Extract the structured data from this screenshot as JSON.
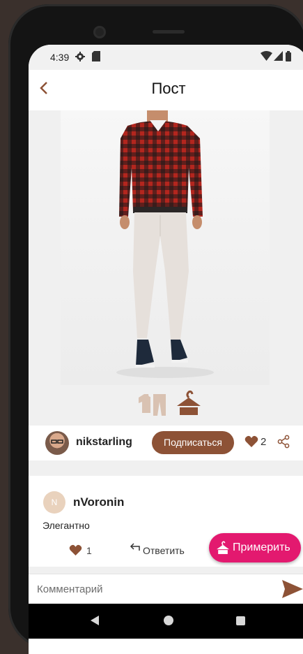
{
  "status_bar": {
    "time": "4:39",
    "icons": [
      "settings-icon",
      "sd-card-icon",
      "wifi-icon",
      "signal-icon",
      "battery-icon"
    ]
  },
  "header": {
    "title": "Пост",
    "back_icon": "chevron-left-icon"
  },
  "post": {
    "image": "man-in-plaid-shirt-and-white-jeans",
    "type_icons": [
      "clothes-icon",
      "hanger-icon"
    ],
    "author": {
      "username": "nikstarling",
      "avatar": "user-avatar-photo"
    },
    "subscribe_label": "Подписаться",
    "likes": "2",
    "share_icon": "share-icon"
  },
  "comment": {
    "avatar_letter": "N",
    "username": "nVoronin",
    "text": "Элегантно",
    "likes": "1",
    "reply_label": "Ответить"
  },
  "fitting_button": {
    "label": "Примерить",
    "icon": "hanger-icon"
  },
  "comment_bar": {
    "placeholder": "Комментарий",
    "value": ""
  },
  "colors": {
    "accent": "#8d5236",
    "fitting": "#e3196f"
  },
  "nav_bar": {
    "icons": [
      "nav-back-icon",
      "nav-home-icon",
      "nav-recents-icon"
    ]
  }
}
